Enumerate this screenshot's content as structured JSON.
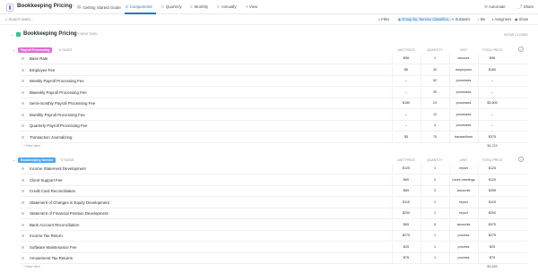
{
  "header": {
    "title": "Bookkeeping Pricing",
    "tabs": [
      {
        "label": "Getting Started Guide",
        "active": false,
        "icon": "doc-icon"
      },
      {
        "label": "Components",
        "active": true,
        "icon": "list-icon"
      },
      {
        "label": "Quarterly",
        "active": false,
        "icon": "list-icon"
      },
      {
        "label": "Monthly",
        "active": false,
        "icon": "list-icon"
      },
      {
        "label": "Annually",
        "active": false,
        "icon": "list-icon"
      }
    ],
    "view_label": "+ View",
    "automate_label": "Automate",
    "share_label": "Share"
  },
  "toolbar": {
    "search_placeholder": "Search tasks...",
    "filter_label": "Filter",
    "group_label": "Group by: Service Classifica...",
    "subtasks_label": "Subtasks",
    "me_label": "Me",
    "assignees_label": "Assignees",
    "show_label": "Show"
  },
  "list": {
    "title": "Bookkeeping Pricing",
    "new_task_label": "+ NEW TASK",
    "show_closed_label": "SHOW CLOSED"
  },
  "columns": {
    "unit_price": "UNIT PRICE",
    "quantity": "QUANTITY",
    "unit": "UNIT",
    "total_price": "TOTAL PRICE"
  },
  "groups": [
    {
      "name": "Payroll Processing",
      "color": "#e26bd4",
      "count": "8 TASKS",
      "new_item_label": "+ New Item",
      "sum": "$4,229",
      "rows": [
        {
          "name": "Base Rate",
          "unit_price": "$98",
          "quantity": "1",
          "unit": "account",
          "total_price": "$98"
        },
        {
          "name": "Employee Fee",
          "unit_price": "$5",
          "quantity": "32",
          "unit": "employees",
          "total_price": "$160"
        },
        {
          "name": "Weekly Payroll Processing Fee",
          "unit_price": "–",
          "quantity": "52",
          "unit": "processes",
          "total_price": "–"
        },
        {
          "name": "Biweekly Payroll Processing Fee",
          "unit_price": "–",
          "quantity": "26",
          "unit": "processes",
          "total_price": "–"
        },
        {
          "name": "Semi-monthly Payroll Processing Fee",
          "unit_price": "$150",
          "quantity": "24",
          "unit": "processes",
          "total_price": "$3,600"
        },
        {
          "name": "Monthly Payroll Processing Fee",
          "unit_price": "–",
          "quantity": "12",
          "unit": "processes",
          "total_price": "–"
        },
        {
          "name": "Quarterly Payroll Processing Fee",
          "unit_price": "–",
          "quantity": "4",
          "unit": "processes",
          "total_price": "–"
        },
        {
          "name": "Transaction Journalizing",
          "unit_price": "$5",
          "quantity": "75",
          "unit": "transactions",
          "total_price": "$375"
        }
      ]
    },
    {
      "name": "Bookkeeping Service",
      "color": "#49a6f3",
      "count": "9 TASKS",
      "new_item_label": "+ New Item",
      "sum": "$1,630",
      "rows": [
        {
          "name": "Income Statement Development",
          "unit_price": "$125",
          "quantity": "1",
          "unit": "report",
          "total_price": "$125"
        },
        {
          "name": "Client Support Fee",
          "unit_price": "$60",
          "quantity": "2",
          "unit": "hours meetings",
          "total_price": "$120"
        },
        {
          "name": "Credit Card Reconciliation",
          "unit_price": "$65",
          "quantity": "3",
          "unit": "accounts",
          "total_price": "$255"
        },
        {
          "name": "Statement of Changes in Equity Development",
          "unit_price": "$115",
          "quantity": "1",
          "unit": "report",
          "total_price": "$115"
        },
        {
          "name": "Statement of Financial Position Development",
          "unit_price": "$200",
          "quantity": "1",
          "unit": "report",
          "total_price": "$200"
        },
        {
          "name": "Bank Account Reconciliation",
          "unit_price": "$65",
          "quantity": "5",
          "unit": "accounts",
          "total_price": "$475"
        },
        {
          "name": "Income Tax Return",
          "unit_price": "$275",
          "quantity": "1",
          "unit": "process",
          "total_price": "$275"
        },
        {
          "name": "Software Maintenance Fee",
          "unit_price": "$25",
          "quantity": "1",
          "unit": "process",
          "total_price": "$25"
        },
        {
          "name": "Amusement Tax Returns",
          "unit_price": "$75",
          "quantity": "1",
          "unit": "process",
          "total_price": "$75"
        }
      ]
    }
  ],
  "colors": {
    "accent": "#1f7bc2",
    "list_icon": "#34c38f"
  }
}
